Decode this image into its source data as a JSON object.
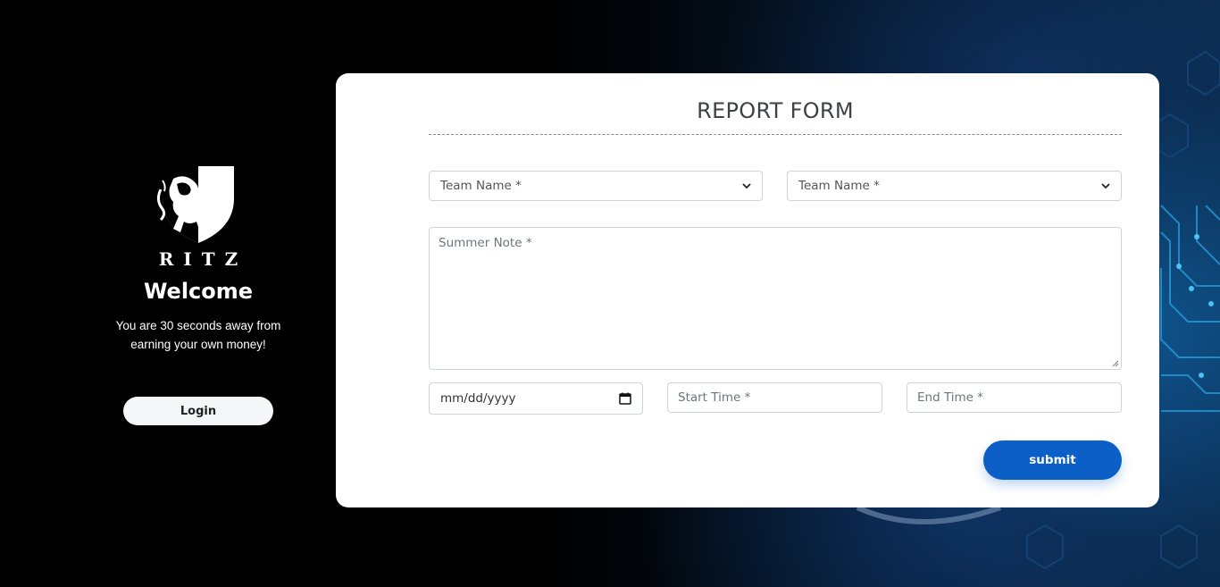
{
  "sidebar": {
    "brand": "RITZ",
    "welcome": "Welcome",
    "tagline": "You are 30 seconds away from earning your own money!",
    "login_label": "Login"
  },
  "form": {
    "title": "REPORT FORM",
    "team_select_1": {
      "placeholder": "Team Name *"
    },
    "team_select_2": {
      "placeholder": "Team Name *"
    },
    "note": {
      "placeholder": "Summer Note *"
    },
    "date": {
      "placeholder": "mm/dd/yyyy"
    },
    "start_time": {
      "placeholder": "Start Time *"
    },
    "end_time": {
      "placeholder": "End Time *"
    },
    "submit_label": "submit"
  },
  "icons": {
    "select_arrow": "chevron-down-icon",
    "date_picker": "calendar-icon",
    "logo": "lion-shield-logo"
  },
  "colors": {
    "submit": "#0d5fc8",
    "card": "#ffffff",
    "title": "#3d4248"
  }
}
